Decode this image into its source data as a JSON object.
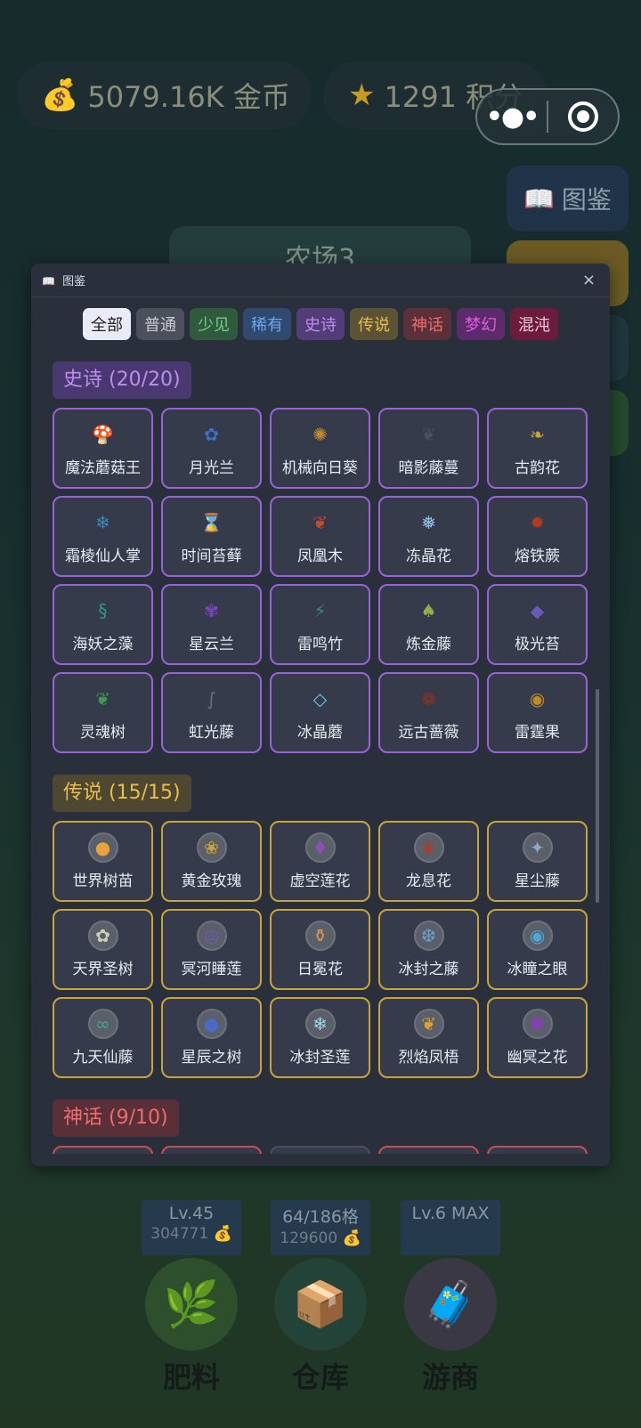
{
  "header": {
    "coins": {
      "icon": "money-bag-icon",
      "text": "5079.16K 金币"
    },
    "points": {
      "icon": "star-icon",
      "text": "1291 积分"
    }
  },
  "side": {
    "tujian_label": "图鉴"
  },
  "farm": {
    "title": "农场3"
  },
  "modal": {
    "title": "图鉴",
    "close": "×",
    "filters": [
      {
        "label": "全部",
        "bg": "#e9ecf6",
        "color": "#222"
      },
      {
        "label": "普通",
        "bg": "#4b505c",
        "color": "#c9ccd3"
      },
      {
        "label": "少见",
        "bg": "#2f5a3d",
        "color": "#6fd081"
      },
      {
        "label": "稀有",
        "bg": "#2f4a6e",
        "color": "#69a7ee"
      },
      {
        "label": "史诗",
        "bg": "#523d79",
        "color": "#bc8df0"
      },
      {
        "label": "传说",
        "bg": "#5c5235",
        "color": "#e9be4b"
      },
      {
        "label": "神话",
        "bg": "#5b3038",
        "color": "#f06b6b"
      },
      {
        "label": "梦幻",
        "bg": "#5b2b6b",
        "color": "#ea57e6"
      },
      {
        "label": "混沌",
        "bg": "#6b1c3c",
        "color": "#f2c9d8"
      }
    ],
    "sections": {
      "epic": {
        "title": "史诗 (20/20)",
        "items": [
          {
            "name": "魔法蘑菇王",
            "icon": "magic-mushroom-icon",
            "glyph": "🍄",
            "bg": "#8a4fbf"
          },
          {
            "name": "月光兰",
            "icon": "moon-orchid-icon",
            "glyph": "✿",
            "bg": "#3a6fc4"
          },
          {
            "name": "机械向日葵",
            "icon": "gear-sunflower-icon",
            "glyph": "✺",
            "bg": "#c08a2a"
          },
          {
            "name": "暗影藤蔓",
            "icon": "shadow-vine-icon",
            "glyph": "❦",
            "bg": "#4a4f5c"
          },
          {
            "name": "古韵花",
            "icon": "ancient-flower-icon",
            "glyph": "❧",
            "bg": "#c6a13c"
          },
          {
            "name": "霜棱仙人掌",
            "icon": "frost-cactus-icon",
            "glyph": "❄",
            "bg": "#3f86c6"
          },
          {
            "name": "时间苔藓",
            "icon": "hourglass-icon",
            "glyph": "⌛",
            "bg": "#b7843a"
          },
          {
            "name": "凤凰木",
            "icon": "phoenix-feather-icon",
            "glyph": "❦",
            "bg": "#c34a2a"
          },
          {
            "name": "冻晶花",
            "icon": "frozen-crystal-icon",
            "glyph": "❅",
            "bg": "#8fc5e8"
          },
          {
            "name": "熔铁蕨",
            "icon": "molten-fern-icon",
            "glyph": "✹",
            "bg": "#b43a24"
          },
          {
            "name": "海妖之藻",
            "icon": "siren-algae-icon",
            "glyph": "§",
            "bg": "#2a9a8a"
          },
          {
            "name": "星云兰",
            "icon": "nebula-orchid-icon",
            "glyph": "✾",
            "bg": "#7b45c2"
          },
          {
            "name": "雷鸣竹",
            "icon": "thunder-bamboo-icon",
            "glyph": "⚡",
            "bg": "#3c8a64"
          },
          {
            "name": "炼金藤",
            "icon": "alchemy-vine-icon",
            "glyph": "♠",
            "bg": "#8fae4a"
          },
          {
            "name": "极光苔",
            "icon": "aurora-moss-icon",
            "glyph": "◆",
            "bg": "#6a5ab8"
          },
          {
            "name": "灵魂树",
            "icon": "soul-leaf-icon",
            "glyph": "❦",
            "bg": "#3d9a52"
          },
          {
            "name": "虹光藤",
            "icon": "rainbow-vine-icon",
            "glyph": "∫",
            "bg": "#6b6f78"
          },
          {
            "name": "冰晶蘑",
            "icon": "ice-cube-icon",
            "glyph": "◇",
            "bg": "#6fc6e6"
          },
          {
            "name": "远古蔷薇",
            "icon": "ancient-rose-icon",
            "glyph": "❁",
            "bg": "#8a3424"
          },
          {
            "name": "雷霆果",
            "icon": "thunder-fruit-icon",
            "glyph": "◉",
            "bg": "#c08a2a"
          }
        ]
      },
      "legend": {
        "title": "传说 (15/15)",
        "items": [
          {
            "name": "世界树苗",
            "icon": "world-seedling-icon",
            "glyph": "●",
            "bg": "#e8a33a"
          },
          {
            "name": "黄金玫瑰",
            "icon": "golden-rose-icon",
            "glyph": "❀",
            "bg": "#c6a13c"
          },
          {
            "name": "虚空莲花",
            "icon": "void-lotus-icon",
            "glyph": "♦",
            "bg": "#8a4fbf"
          },
          {
            "name": "龙息花",
            "icon": "dragon-breath-icon",
            "glyph": "❦",
            "bg": "#b23a2a"
          },
          {
            "name": "星尘藤",
            "icon": "stardust-vine-icon",
            "glyph": "✦",
            "bg": "#8fa6c6"
          },
          {
            "name": "天界圣树",
            "icon": "celestial-tree-icon",
            "glyph": "✿",
            "bg": "#c9d2b0"
          },
          {
            "name": "冥河睡莲",
            "icon": "styx-lotus-icon",
            "glyph": "◎",
            "bg": "#6a5ab8"
          },
          {
            "name": "日冕花",
            "icon": "corona-bottle-icon",
            "glyph": "⚱",
            "bg": "#d49a4a"
          },
          {
            "name": "冰封之藤",
            "icon": "frozen-vine-icon",
            "glyph": "❆",
            "bg": "#6a9ac6"
          },
          {
            "name": "冰瞳之眼",
            "icon": "ice-eye-icon",
            "glyph": "◉",
            "bg": "#4fa6d8"
          },
          {
            "name": "九天仙藤",
            "icon": "nine-heaven-vine-icon",
            "glyph": "∞",
            "bg": "#3daa8a"
          },
          {
            "name": "星辰之树",
            "icon": "star-tree-icon",
            "glyph": "●",
            "bg": "#4a6ac6"
          },
          {
            "name": "冰封圣莲",
            "icon": "frozen-holy-lotus-icon",
            "glyph": "❄",
            "bg": "#9ad8ea"
          },
          {
            "name": "烈焰凤梧",
            "icon": "flame-maple-leaf-icon",
            "glyph": "❦",
            "bg": "#e0a22a"
          },
          {
            "name": "幽冥之花",
            "icon": "netherworld-flower-icon",
            "glyph": "✺",
            "bg": "#8a3ac6"
          }
        ]
      },
      "myth": {
        "title": "神话 (9/10)"
      }
    }
  },
  "bottom": {
    "stats": [
      {
        "line1": "Lv.45",
        "line2": "304771 💰"
      },
      {
        "line1": "64/186格",
        "line2": "129600 💰"
      },
      {
        "line1": "Lv.6 MAX",
        "line2": ""
      }
    ],
    "buttons": [
      {
        "label": "肥料",
        "icon": "fertilizer-branch-icon",
        "glyph": "🌿",
        "bg": "#2e4f2b"
      },
      {
        "label": "仓库",
        "icon": "warehouse-box-icon",
        "glyph": "📦",
        "bg": "#234238"
      },
      {
        "label": "游商",
        "icon": "suitcase-icon",
        "glyph": "🧳",
        "bg": "#3b3846"
      }
    ]
  }
}
